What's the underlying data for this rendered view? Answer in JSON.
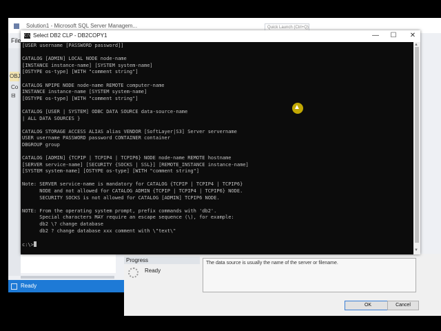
{
  "background_app": {
    "title": "Solution1 - Microsoft SQL Server Managem...",
    "quick_launch_placeholder": "Quick Launch (Ctrl+Q)",
    "menu_file": "File",
    "left_items": [
      "OBJ",
      "Co",
      "⊟"
    ],
    "status": "Ready"
  },
  "console": {
    "title": "Select DB2 CLP - DB2COPY1",
    "icon_label": "C:\\",
    "window_controls": [
      "minimize-icon",
      "maximize-icon",
      "close-icon"
    ],
    "lines": [
      "[USER username [PASSWORD password]]",
      "",
      "CATALOG [ADMIN] LOCAL NODE node-name",
      "[INSTANCE instance-name] [SYSTEM system-name]",
      "[OSTYPE os-type] [WITH \"comment string\"]",
      "",
      "CATALOG NPIPE NODE node-name REMOTE computer-name",
      "INSTANCE instance-name [SYSTEM system-name]",
      "[OSTYPE os-type] [WITH \"comment string\"]",
      "",
      "CATALOG [USER | SYSTEM] ODBC DATA SOURCE data-source-name",
      "| ALL DATA SOURCES }",
      "",
      "CATALOG STORAGE ACCESS ALIAS alias VENDOR [SoftLayer|S3] Server servername",
      "USER username PASSWORD password CONTAINER container",
      "DBGROUP group",
      "",
      "CATALOG [ADMIN] {TCPIP | TCPIP4 | TCPIP6} NODE node-name REMOTE hostname",
      "[SERVER service-name] [SECURITY {SOCKS | SSL}] [REMOTE_INSTANCE instance-name]",
      "[SYSTEM system-name] [OSTYPE os-type] [WITH \"comment string\"]",
      "",
      "Note: SERVER service-name is mandatory for CATALOG {TCPIP | TCPIP4 | TCPIP6}",
      "      NODE and not allowed for CATALOG ADMIN {TCPIP | TCPIP4 | TCPIP6} NODE.",
      "      SECURITY SOCKS is not allowed for CATALOG [ADMIN] TCPIP6 NODE.",
      "",
      "NOTE: From the operating system prompt, prefix commands with 'db2'.",
      "      Special characters MAY require an escape sequence (\\), for example:",
      "      db2 \\? change database",
      "      db2 ? change database xxx comment with \\\"text\\\"",
      "",
      "c:\\>"
    ]
  },
  "dialog": {
    "progress_label": "Progress",
    "status": "Ready",
    "description": "The data source is usually the name of the server or filename.",
    "ok_label": "OK",
    "cancel_label": "Cancel"
  },
  "colors": {
    "console_bg": "#0c0c0c",
    "console_text": "#c0c0c0",
    "status_bar": "#1e7ad6"
  }
}
